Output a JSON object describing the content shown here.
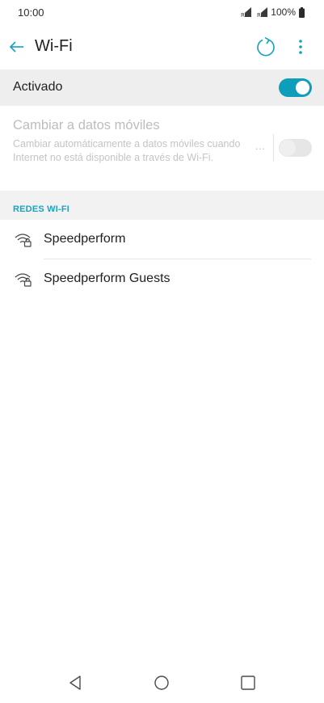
{
  "status_bar": {
    "time": "10:00",
    "battery_percent": "100%",
    "signal_labels": [
      "R",
      "R"
    ]
  },
  "header": {
    "title": "Wi-Fi"
  },
  "wifi_master": {
    "label": "Activado",
    "enabled": true
  },
  "mobile_data_switch": {
    "title": "Cambiar a datos móviles",
    "description": "Cambiar automáticamente a datos móviles cuando Internet no está disponible a través de Wi-Fi.",
    "more": "...",
    "enabled": false
  },
  "networks_section": {
    "header": "REDES WI-FI",
    "items": [
      {
        "name": "Speedperform",
        "icon": "wifi-lock-icon"
      },
      {
        "name": "Speedperform Guests",
        "icon": "wifi-lock-icon"
      }
    ]
  },
  "colors": {
    "accent": "#0e9dbb",
    "section_header_text": "#1aa3c3",
    "master_row_bg": "#eeeeee"
  }
}
